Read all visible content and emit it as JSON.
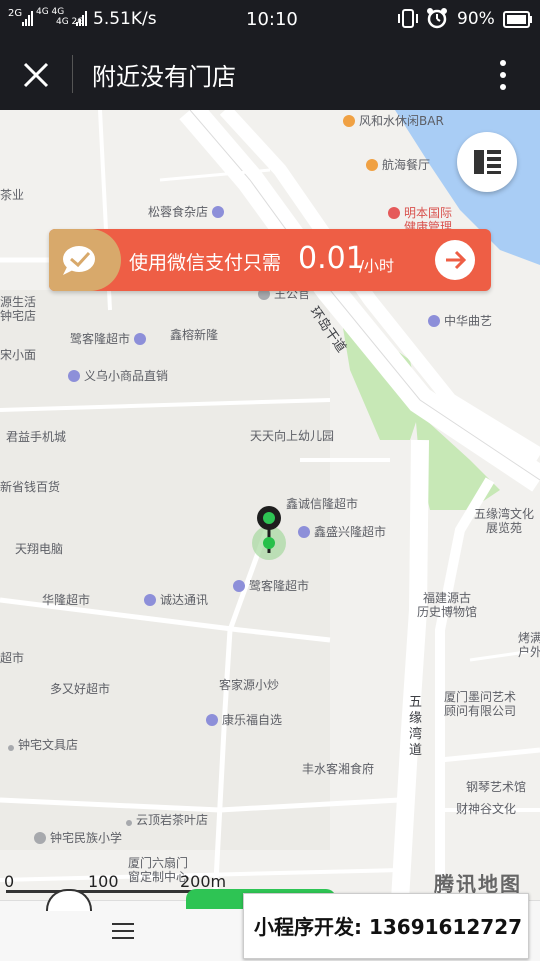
{
  "status_bar": {
    "signal_left": "2G",
    "network_a": "4G 4G",
    "network_b": "4G 2G",
    "speed": "5.51K/s",
    "time": "10:10",
    "battery": "90%"
  },
  "title_bar": {
    "title": "附近没有门店",
    "close_icon": "close-icon",
    "menu_icon": "more-vertical-icon"
  },
  "banner": {
    "prefix": "使用微信支付只需",
    "price": "0.01",
    "unit": "/小时"
  },
  "map": {
    "pois": [
      {
        "name": "风和水休闲BAR",
        "icon": "orange"
      },
      {
        "name": "航海餐厅",
        "icon": "orange"
      },
      {
        "name": "松蓉食杂店",
        "icon": "purple"
      },
      {
        "name": "明本国际",
        "icon": "red"
      },
      {
        "name": "健康管理",
        "icon": "none"
      },
      {
        "name": "王公官",
        "icon": "gray"
      },
      {
        "name": "源生活",
        "icon": "none"
      },
      {
        "name": "钟宅店",
        "icon": "none"
      },
      {
        "name": "鹭客隆超市",
        "icon": "purple"
      },
      {
        "name": "鑫榕新隆",
        "icon": "none"
      },
      {
        "name": "中华曲艺",
        "icon": "purple"
      },
      {
        "name": "宋小面",
        "icon": "none"
      },
      {
        "name": "义乌小商品直销",
        "icon": "purple"
      },
      {
        "name": "君益手机城",
        "icon": "purple"
      },
      {
        "name": "天天向上幼儿园",
        "icon": "none"
      },
      {
        "name": "新省钱百货",
        "icon": "purple"
      },
      {
        "name": "鑫诚信隆超市",
        "icon": "purple"
      },
      {
        "name": "五缘湾文化",
        "icon": "purple"
      },
      {
        "name": "展览苑",
        "icon": "none"
      },
      {
        "name": "鑫盛兴隆超市",
        "icon": "purple"
      },
      {
        "name": "天翔电脑",
        "icon": "purple"
      },
      {
        "name": "鹭客隆超市",
        "icon": "purple"
      },
      {
        "name": "华隆超市",
        "icon": "purple"
      },
      {
        "name": "诚达通讯",
        "icon": "purple"
      },
      {
        "name": "福建源古",
        "icon": "none"
      },
      {
        "name": "历史博物馆",
        "icon": "none"
      },
      {
        "name": "烤满",
        "icon": "none"
      },
      {
        "name": "户外",
        "icon": "none"
      },
      {
        "name": "超市",
        "icon": "none"
      },
      {
        "name": "客家源小炒",
        "icon": "orange"
      },
      {
        "name": "多又好超市",
        "icon": "purple"
      },
      {
        "name": "厦门墨问艺术",
        "icon": "none"
      },
      {
        "name": "顾问有限公司",
        "icon": "none"
      },
      {
        "name": "康乐福自选",
        "icon": "purple"
      },
      {
        "name": "钟宅文具店",
        "icon": "gray"
      },
      {
        "name": "丰水客湘食府",
        "icon": "orange"
      },
      {
        "name": "钢琴艺术馆",
        "icon": "none"
      },
      {
        "name": "财神谷文化",
        "icon": "none"
      },
      {
        "name": "云顶岩茶叶店",
        "icon": "gray"
      },
      {
        "name": "钟宅民族小学",
        "icon": "gray"
      },
      {
        "name": "厦门六扇门",
        "icon": "none"
      },
      {
        "name": "窗定制中心",
        "icon": "none"
      },
      {
        "name": "茶业",
        "icon": "none"
      }
    ],
    "roads": [
      "环岛干道",
      "五缘湾道"
    ],
    "scale_0": "0",
    "scale_100": "100",
    "scale_200": "200m",
    "watermark": "腾讯地图"
  },
  "bottom_bar": {
    "menu_icon": "hamburger-icon"
  },
  "dev_badge": {
    "text": "小程序开发: 13691612727"
  }
}
